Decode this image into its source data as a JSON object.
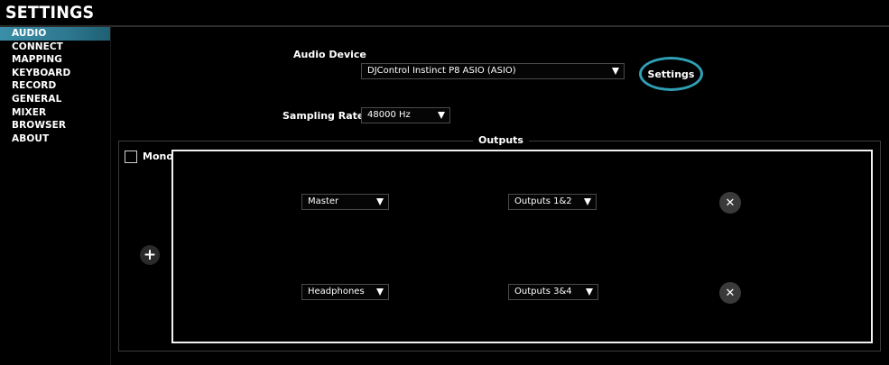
{
  "header": {
    "title": "SETTINGS"
  },
  "sidebar": {
    "items": [
      {
        "label": "AUDIO",
        "active": true
      },
      {
        "label": "CONNECT"
      },
      {
        "label": "MAPPING"
      },
      {
        "label": "KEYBOARD"
      },
      {
        "label": "RECORD"
      },
      {
        "label": "GENERAL"
      },
      {
        "label": "MIXER"
      },
      {
        "label": "BROWSER"
      },
      {
        "label": "ABOUT"
      }
    ]
  },
  "audio": {
    "device_label": "Audio Device",
    "device_value": "DJControl Instinct P8 ASIO (ASIO)",
    "settings_label": "Settings",
    "sampling_label": "Sampling Rate:",
    "sampling_value": "48000 Hz"
  },
  "outputs": {
    "title": "Outputs",
    "mono_label": "Mono",
    "mono_checked": false,
    "add_symbol": "+",
    "rows": [
      {
        "source": "Master",
        "target": "Outputs 1&2",
        "remove_symbol": "✕"
      },
      {
        "source": "Headphones",
        "target": "Outputs 3&4",
        "remove_symbol": "✕"
      }
    ]
  },
  "colors": {
    "accent": "#2fa0b5",
    "active_tab": "#3a8fa8",
    "background": "#000000"
  },
  "icons": {
    "dropdown": "triangle-down-icon",
    "add": "plus-icon",
    "remove": "close-icon"
  }
}
